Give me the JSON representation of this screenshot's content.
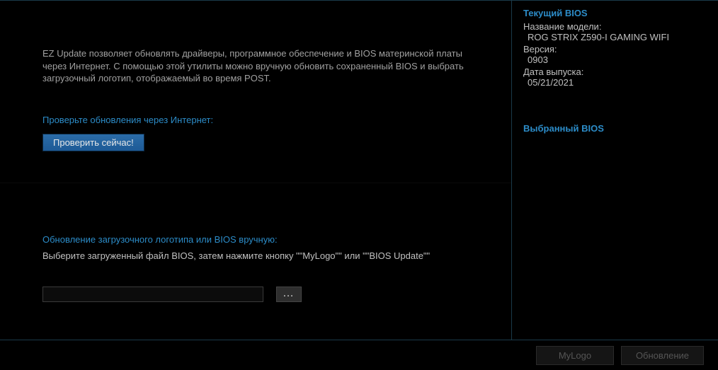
{
  "main": {
    "description": "EZ Update позволяет обновлять драйверы, программное обеспечение и BIOS материнской платы через Интернет. С помощью этой утилиты можно вручную обновить сохраненный BIOS и выбрать загрузочный логотип, отображаемый во время POST.",
    "check_section_label": "Проверьте обновления через Интернет:",
    "check_button": "Проверить сейчас!",
    "manual_section_label": "Обновление загрузочного логотипа или BIOS вручную:",
    "manual_description": "Выберите загруженный файл BIOS, затем нажмите кнопку \"\"MyLogo\"\" или \"\"BIOS Update\"\"",
    "file_input_value": "",
    "browse_label": "..."
  },
  "sidebar": {
    "current_bios_heading": "Текущий BIOS",
    "model_label": "Название модели:",
    "model_value": "ROG STRIX Z590-I GAMING WIFI",
    "version_label": "Версия:",
    "version_value": "0903",
    "date_label": "Дата выпуска:",
    "date_value": "05/21/2021",
    "selected_bios_heading": "Выбранный BIOS"
  },
  "footer": {
    "mylogo_button": "MyLogo",
    "update_button": "Обновление"
  }
}
